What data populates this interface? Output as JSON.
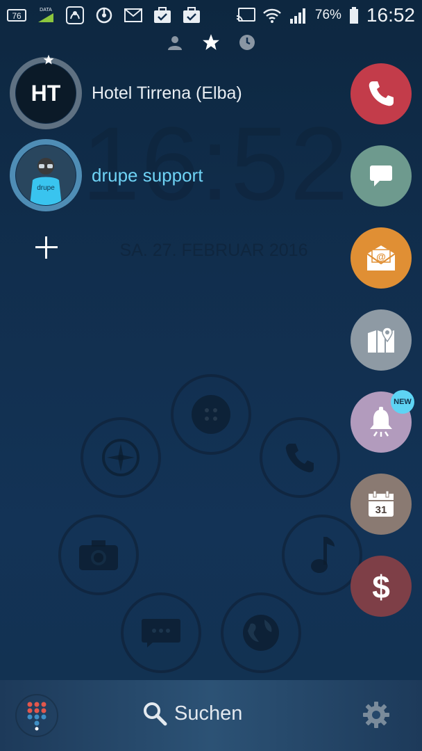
{
  "status_bar": {
    "notification_badge": "76",
    "data_label": "DATA",
    "battery_percent": "76%",
    "time": "16:52"
  },
  "tabs": [
    {
      "icon": "person-icon",
      "active": false
    },
    {
      "icon": "star-icon",
      "active": true
    },
    {
      "icon": "clock-icon",
      "active": false
    }
  ],
  "lockscreen": {
    "clock": "16:52",
    "date": "SA. 27. FEBRUAR 2016"
  },
  "contacts": [
    {
      "initials": "HT",
      "name": "Hotel Tirrena (Elba)",
      "favorite": true
    },
    {
      "avatar_text": "drupe",
      "name": "drupe support"
    }
  ],
  "actions": [
    {
      "name": "call",
      "icon": "phone-icon",
      "color": "#c33c4a"
    },
    {
      "name": "message",
      "icon": "chat-icon",
      "color": "#6e9a8e"
    },
    {
      "name": "email",
      "icon": "email-icon",
      "color": "#e08f34"
    },
    {
      "name": "map",
      "icon": "map-icon",
      "color": "#8e9aa4"
    },
    {
      "name": "reminder",
      "icon": "bell-icon",
      "color": "#b29bbd",
      "badge": "NEW"
    },
    {
      "name": "calendar",
      "icon": "calendar-icon",
      "color": "#8a7a72",
      "date": "31"
    },
    {
      "name": "payment",
      "icon": "dollar-icon",
      "color": "#7e3f47"
    }
  ],
  "bottom_bar": {
    "search_label": "Suchen"
  }
}
